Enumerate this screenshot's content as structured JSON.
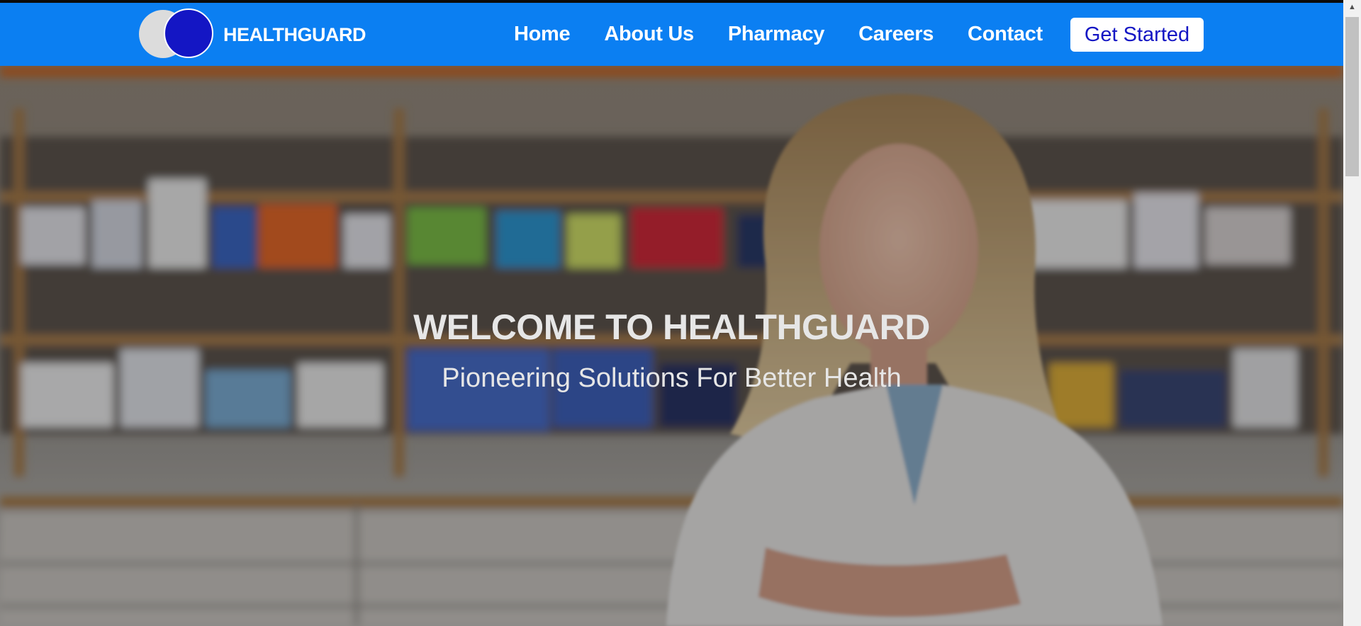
{
  "brand": {
    "name": "HEALTHGUARD"
  },
  "nav": {
    "items": [
      {
        "label": "Home"
      },
      {
        "label": "About Us"
      },
      {
        "label": "Pharmacy"
      },
      {
        "label": "Careers"
      },
      {
        "label": "Contact"
      }
    ],
    "cta_label": "Get Started"
  },
  "hero": {
    "title": "WELCOME TO HEALTHGUARD",
    "subtitle": "Pioneering Solutions For Better Health",
    "image_subject": "pharmacist-in-front-of-shelves"
  },
  "colors": {
    "navbar": "#0b7ff2",
    "logo_primary": "#1416c4",
    "logo_secondary": "#dcdcdc",
    "cta_text": "#1416c4",
    "hero_text": "#e6e6e6"
  },
  "scrollbar": {
    "up_icon": "arrow-up-icon"
  }
}
